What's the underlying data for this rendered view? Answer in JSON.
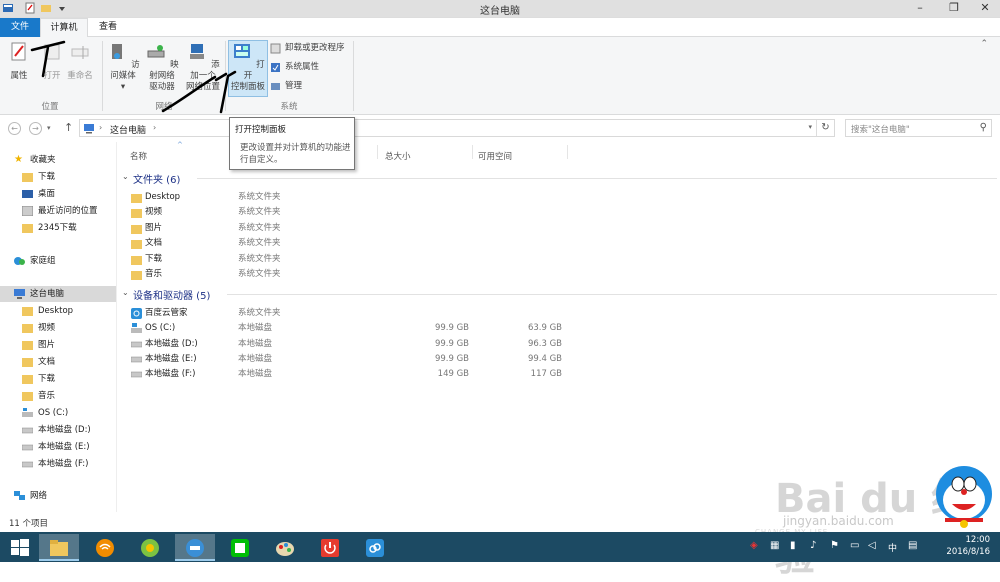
{
  "window": {
    "title": "这台电脑",
    "controls": [
      "minimize-icon",
      "restore-icon",
      "close-icon"
    ]
  },
  "ribbon_tabs": {
    "file": "文件",
    "computer": "计算机",
    "view": "查看"
  },
  "ribbon": {
    "location_group": {
      "label": "位置",
      "properties": "属性",
      "open": "打开",
      "rename": "重命名"
    },
    "network_group": {
      "label": "网络",
      "media": "访问媒体",
      "map_drive_1": "映射网络",
      "map_drive_2": "驱动器",
      "add_location_1": "添加一个",
      "add_location_2": "网络位置"
    },
    "system_group": {
      "label": "系统",
      "control_panel_1": "打开",
      "control_panel_2": "控制面板",
      "uninstall": "卸载或更改程序",
      "system_properties": "系统属性",
      "manage": "管理"
    }
  },
  "address_bar": {
    "crumb": "这台电脑",
    "search_placeholder": "搜索\"这台电脑\""
  },
  "tooltip": {
    "title": "打开控制面板",
    "description": "更改设置并对计算机的功能进行自定义。"
  },
  "sidebar": {
    "favorites": "收藏夹",
    "fav_items": [
      "下载",
      "桌面",
      "最近访问的位置",
      "2345下载"
    ],
    "homegroup": "家庭组",
    "this_pc": "这台电脑",
    "pc_items": [
      "Desktop",
      "视频",
      "图片",
      "文档",
      "下载",
      "音乐",
      "OS (C:)",
      "本地磁盘 (D:)",
      "本地磁盘 (E:)",
      "本地磁盘 (F:)"
    ],
    "network": "网络"
  },
  "columns": {
    "name": "名称",
    "total_size": "总大小",
    "free_space": "可用空间"
  },
  "folders": {
    "header": "文件夹 (6)",
    "items": [
      {
        "name": "Desktop",
        "type": "系统文件夹"
      },
      {
        "name": "视频",
        "type": "系统文件夹"
      },
      {
        "name": "图片",
        "type": "系统文件夹"
      },
      {
        "name": "文档",
        "type": "系统文件夹"
      },
      {
        "name": "下载",
        "type": "系统文件夹"
      },
      {
        "name": "音乐",
        "type": "系统文件夹"
      }
    ]
  },
  "devices": {
    "header": "设备和驱动器 (5)",
    "items": [
      {
        "name": "百度云管家",
        "type": "系统文件夹",
        "total": "",
        "free": ""
      },
      {
        "name": "OS (C:)",
        "type": "本地磁盘",
        "total": "99.9 GB",
        "free": "63.9 GB"
      },
      {
        "name": "本地磁盘 (D:)",
        "type": "本地磁盘",
        "total": "99.9 GB",
        "free": "96.3 GB"
      },
      {
        "name": "本地磁盘 (E:)",
        "type": "本地磁盘",
        "total": "99.9 GB",
        "free": "99.4 GB"
      },
      {
        "name": "本地磁盘 (F:)",
        "type": "本地磁盘",
        "total": "149 GB",
        "free": "117 GB"
      }
    ]
  },
  "status": {
    "count": "11 个项目"
  },
  "taskbar": {
    "ime": "中",
    "time": "12:00",
    "date": "2016/8/16",
    "apps": [
      "windows-start-icon",
      "file-explorer-icon",
      "wifi-app-icon",
      "browser-icon",
      "explorer-app-icon",
      "iqiyi-icon",
      "paint-icon",
      "power-app-icon",
      "cloud-app-icon"
    ]
  },
  "watermark": {
    "brand": "Bai du 经验",
    "url": "jingyan.baidu.com",
    "sub": "CHANGE MY LIFE"
  },
  "colors": {
    "file_tab": "#1979ca",
    "group_header": "#1e3287",
    "taskbar": "#1c4a63",
    "ribbon_bg": "#f5f6f7"
  }
}
